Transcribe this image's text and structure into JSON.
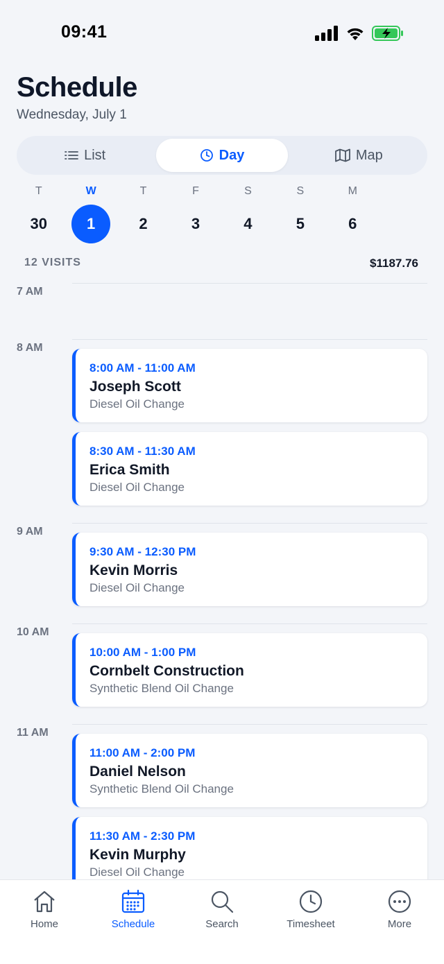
{
  "status_bar": {
    "time": "09:41"
  },
  "header": {
    "title": "Schedule",
    "date": "Wednesday, July 1"
  },
  "view_toggle": [
    {
      "label": "List",
      "icon": "list-icon"
    },
    {
      "label": "Day",
      "icon": "clock-icon",
      "selected": true
    },
    {
      "label": "Map",
      "icon": "map-icon"
    }
  ],
  "week": [
    {
      "letter": "T",
      "num": "30"
    },
    {
      "letter": "W",
      "num": "1",
      "selected": true
    },
    {
      "letter": "T",
      "num": "2"
    },
    {
      "letter": "F",
      "num": "3"
    },
    {
      "letter": "S",
      "num": "4"
    },
    {
      "letter": "S",
      "num": "5"
    },
    {
      "letter": "M",
      "num": "6"
    }
  ],
  "summary": {
    "visits": "12 VISITS",
    "total": "$1187.76"
  },
  "hours": [
    "7 AM",
    "8 AM",
    "9 AM",
    "10 AM",
    "11 AM"
  ],
  "visits": [
    {
      "time": "8:00 AM - 11:00 AM",
      "name": "Joseph Scott",
      "service": "Diesel Oil Change"
    },
    {
      "time": "8:30 AM - 11:30 AM",
      "name": "Erica Smith",
      "service": "Diesel Oil Change"
    },
    {
      "time": "9:30 AM - 12:30 PM",
      "name": "Kevin Morris",
      "service": "Diesel Oil Change"
    },
    {
      "time": "10:00 AM - 1:00 PM",
      "name": "Cornbelt Construction",
      "service": "Synthetic Blend Oil Change"
    },
    {
      "time": "11:00 AM - 2:00 PM",
      "name": "Daniel Nelson",
      "service": "Synthetic Blend Oil Change"
    },
    {
      "time": "11:30 AM - 2:30 PM",
      "name": "Kevin Murphy",
      "service": "Diesel Oil Change"
    }
  ],
  "tabbar": [
    {
      "label": "Home",
      "icon": "home-icon"
    },
    {
      "label": "Schedule",
      "icon": "calendar-icon",
      "selected": true
    },
    {
      "label": "Search",
      "icon": "search-icon"
    },
    {
      "label": "Timesheet",
      "icon": "clock-icon"
    },
    {
      "label": "More",
      "icon": "more-icon"
    }
  ],
  "colors": {
    "accent": "#0a5cff",
    "background": "#f3f5f9",
    "battery": "#34c759"
  }
}
